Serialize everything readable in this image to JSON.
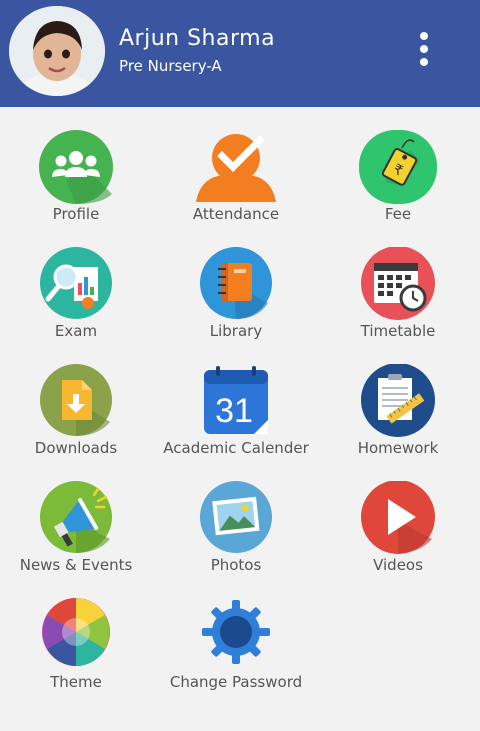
{
  "header": {
    "name": "Arjun Sharma",
    "class": "Pre Nursery-A",
    "bg_color": "#3a56a0"
  },
  "tiles": [
    {
      "label": "Profile",
      "icon": "profile-group-icon",
      "color": "#45b34f"
    },
    {
      "label": "Attendance",
      "icon": "attendance-check-icon",
      "color": "#f37e20"
    },
    {
      "label": "Fee",
      "icon": "fee-rupee-tag-icon",
      "color": "#2fc56f"
    },
    {
      "label": "Exam",
      "icon": "exam-magnifier-chart-icon",
      "color": "#2cb59f"
    },
    {
      "label": "Library",
      "icon": "library-notebook-icon",
      "color": "#2f94d8"
    },
    {
      "label": "Timetable",
      "icon": "timetable-calendar-clock-icon",
      "color": "#e85157"
    },
    {
      "label": "Downloads",
      "icon": "downloads-file-icon",
      "color": "#8aa24a"
    },
    {
      "label": "Academic Calender",
      "icon": "academic-calendar-icon",
      "color": "#2e75d8"
    },
    {
      "label": "Homework",
      "icon": "homework-notepad-ruler-icon",
      "color": "#1f4d8c"
    },
    {
      "label": "News & Events",
      "icon": "news-megaphone-icon",
      "color": "#7cba3a"
    },
    {
      "label": "Photos",
      "icon": "photos-picture-icon",
      "color": "#5aa6d6"
    },
    {
      "label": "Videos",
      "icon": "videos-play-icon",
      "color": "#e0473b"
    },
    {
      "label": "Theme",
      "icon": "theme-color-wheel-icon",
      "color": "#e94e8f"
    },
    {
      "label": "Change Password",
      "icon": "change-password-gear-icon",
      "color": "#2f7fd8"
    }
  ],
  "calendar_day": "31"
}
